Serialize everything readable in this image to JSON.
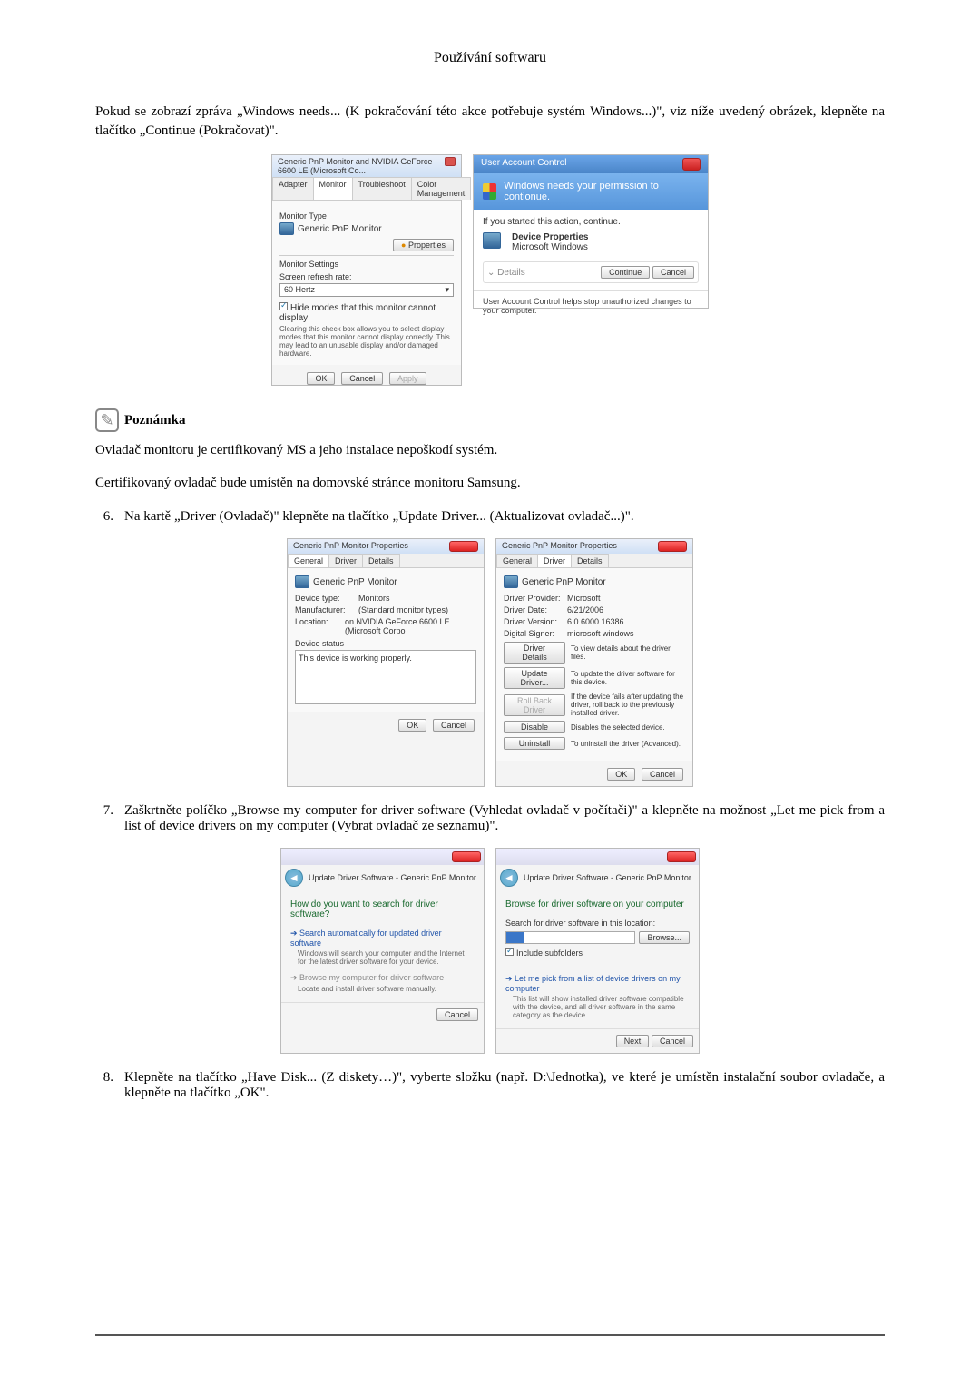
{
  "header": "Používání softwaru",
  "intro": "Pokud se zobrazí zpráva „Windows needs... (K pokračování této akce potřebuje systém Windows...)\", viz níže uvedený obrázek, klepněte na tlačítko „Continue (Pokračovat)\".",
  "dialog1": {
    "title": "Generic PnP Monitor and NVIDIA GeForce 6600 LE (Microsoft Co...",
    "tabs": [
      "Adapter",
      "Monitor",
      "Troubleshoot",
      "Color Management"
    ],
    "monitorTypeLabel": "Monitor Type",
    "monitorName": "Generic PnP Monitor",
    "propertiesBtn": "Properties",
    "settingsLabel": "Monitor Settings",
    "refreshLabel": "Screen refresh rate:",
    "refreshValue": "60 Hertz",
    "hideCheck": "Hide modes that this monitor cannot display",
    "hideDesc": "Clearing this check box allows you to select display modes that this monitor cannot display correctly. This may lead to an unusable display and/or damaged hardware.",
    "ok": "OK",
    "cancel": "Cancel",
    "apply": "Apply"
  },
  "uac": {
    "title": "User Account Control",
    "banner": "Windows needs your permission to contionue.",
    "started": "If you started this action, continue.",
    "prog1": "Device Properties",
    "prog2": "Microsoft Windows",
    "details": "Details",
    "continue": "Continue",
    "cancel": "Cancel",
    "foot": "User Account Control helps stop unauthorized changes to your computer."
  },
  "note": {
    "label": "Poznámka"
  },
  "noteP1": "Ovladač monitoru je certifikovaný MS a jeho instalace nepoškodí systém.",
  "noteP2": "Certifikovaný ovladač bude umístěn na domovské stránce monitoru Samsung.",
  "step6": {
    "num": "6.",
    "text": "Na kartě „Driver (Ovladač)\" klepněte na tlačítko „Update Driver... (Aktualizovat ovladač...)\"."
  },
  "drvGen": {
    "title": "Generic PnP Monitor Properties",
    "tabs": [
      "General",
      "Driver",
      "Details"
    ],
    "name": "Generic PnP Monitor",
    "devType": "Device type:",
    "devTypeV": "Monitors",
    "manu": "Manufacturer:",
    "manuV": "(Standard monitor types)",
    "loc": "Location:",
    "locV": "on NVIDIA GeForce 6600 LE (Microsoft Corpo",
    "statusLbl": "Device status",
    "statusTxt": "This device is working properly.",
    "ok": "OK",
    "cancel": "Cancel"
  },
  "drvDrv": {
    "title": "Generic PnP Monitor Properties",
    "tabs": [
      "General",
      "Driver",
      "Details"
    ],
    "name": "Generic PnP Monitor",
    "prov": "Driver Provider:",
    "provV": "Microsoft",
    "date": "Driver Date:",
    "dateV": "6/21/2006",
    "ver": "Driver Version:",
    "verV": "6.0.6000.16386",
    "sign": "Digital Signer:",
    "signV": "microsoft windows",
    "btns": [
      {
        "l": "Driver Details",
        "d": "To view details about the driver files."
      },
      {
        "l": "Update Driver...",
        "d": "To update the driver software for this device."
      },
      {
        "l": "Roll Back Driver",
        "d": "If the device fails after updating the driver, roll back to the previously installed driver."
      },
      {
        "l": "Disable",
        "d": "Disables the selected device."
      },
      {
        "l": "Uninstall",
        "d": "To uninstall the driver (Advanced)."
      }
    ],
    "ok": "OK",
    "cancel": "Cancel"
  },
  "step7": {
    "num": "7.",
    "text": "Zaškrtněte políčko „Browse my computer for driver software (Vyhledat ovladač v počítači)\" a klepněte na možnost „Let me pick from a list of device drivers on my computer (Vybrat ovladač ze seznamu)\"."
  },
  "wiz1": {
    "crumb": "Update Driver Software - Generic PnP Monitor",
    "q": "How do you want to search for driver software?",
    "opt1": "Search automatically for updated driver software",
    "opt1d": "Windows will search your computer and the Internet for the latest driver software for your device.",
    "opt2": "Browse my computer for driver software",
    "opt2d": "Locate and install driver software manually.",
    "cancel": "Cancel"
  },
  "wiz2": {
    "crumb": "Update Driver Software - Generic PnP Monitor",
    "q": "Browse for driver software on your computer",
    "locLbl": "Search for driver software in this location:",
    "browse": "Browse...",
    "sub": "Include subfolders",
    "opt": "Let me pick from a list of device drivers on my computer",
    "optd": "This list will show installed driver software compatible with the device, and all driver software in the same category as the device.",
    "next": "Next",
    "cancel": "Cancel"
  },
  "step8": {
    "num": "8.",
    "text": "Klepněte na tlačítko „Have Disk... (Z diskety…)\", vyberte složku (např. D:\\Jednotka), ve které je umístěn instalační soubor ovladače, a klepněte na tlačítko „OK\"."
  }
}
